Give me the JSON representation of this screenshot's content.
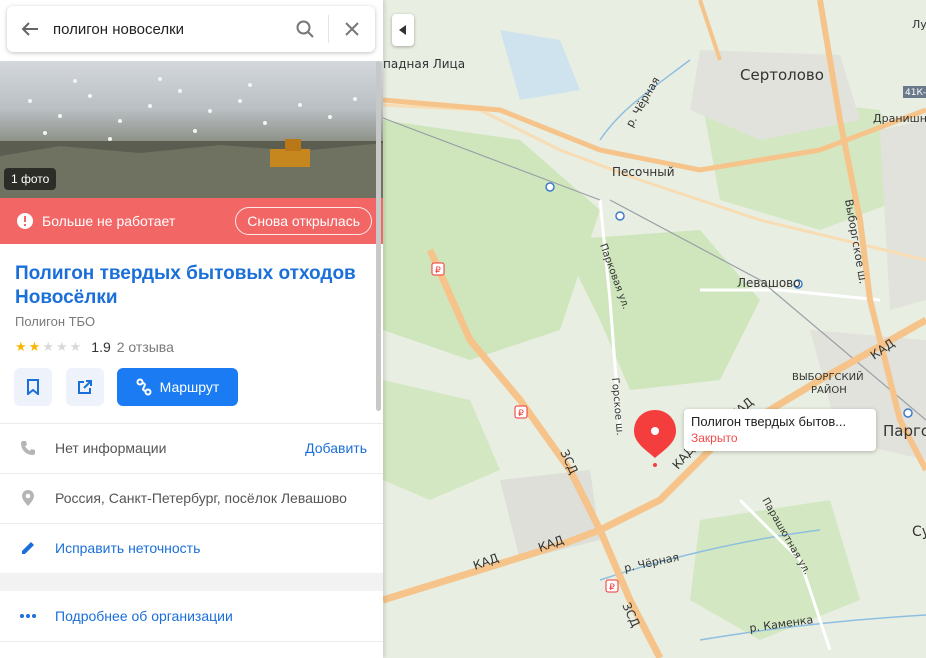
{
  "search": {
    "query": "полигон новоселки",
    "icons": {
      "back": "arrow-left-icon",
      "search": "search-icon",
      "clear": "close-icon"
    }
  },
  "card": {
    "photo_count": "1 фото",
    "closed_status": "Больше не работает",
    "reopened_button": "Снова открылась",
    "title": "Полигон твердых бытовых отходов Новосёлки",
    "category": "Полигон ТБО",
    "rating": {
      "stars_filled": 2,
      "stars_total": 5,
      "value": "1.9",
      "reviews": "2 отзыва"
    },
    "route_button": "Маршрут",
    "phone": {
      "text": "Нет информации",
      "action": "Добавить"
    },
    "address": "Россия, Санкт-Петербург, посёлок Левашово",
    "edit_link": "Исправить неточность",
    "more_link": "Подробнее об организации"
  },
  "map": {
    "labels": {
      "sertolovo": "Сертолово",
      "pesochny": "Песочный",
      "levashovo": "Левашово",
      "pargolovo": "Парго",
      "zapadnaya_litsa": "падная Лица",
      "vyborgsky_rayon_1": "ВЫБОРГСКИЙ",
      "vyborgsky_rayon_2": "РАЙОН",
      "river_chernaya_1": "р. Чёрная",
      "river_chernaya_2": "р. Чёрная",
      "river_kamenka": "р. Каменка",
      "vyborgskoe_sh": "Выборгское ш.",
      "parkovaya_ul": "Парковая ул.",
      "gorskoe_sh": "Горское ш.",
      "parashyutnaya_ul": "Парашютная ул.",
      "kad_1": "КАД",
      "kad_2": "КАД",
      "kad_3": "КАД",
      "kad_4": "КАД",
      "kad_5": "КАД",
      "zsd_1": "ЗСД",
      "zsd_2": "ЗСД",
      "route_badge": "41К-",
      "lu": "Лу",
      "dranishni": "Дранишни",
      "su": "Су"
    },
    "pin_tooltip": {
      "name": "Полигон твердых бытов...",
      "status": "Закрыто"
    }
  },
  "colors": {
    "accent": "#1a7bf2",
    "closed_bar": "#f36666",
    "title_link": "#1a6fd9",
    "star_on": "#f8b600",
    "pin": "#f43e3e",
    "road_major": "#f6c48a"
  }
}
